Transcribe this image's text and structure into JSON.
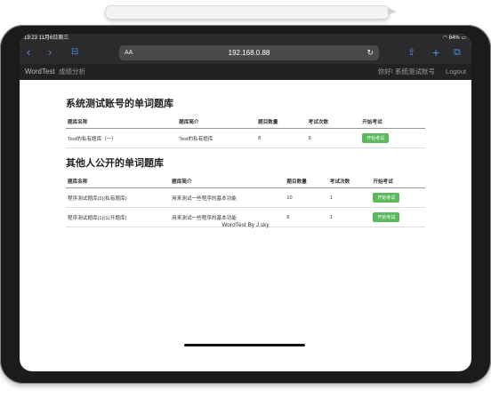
{
  "status": {
    "time_date": "19:23  11月6日周三",
    "battery": "84%"
  },
  "browser": {
    "address": "192.168.0.88",
    "aa_label": "AA",
    "icons": [
      "back-icon",
      "forward-icon",
      "bookmarks-icon",
      "reload-icon",
      "share-icon",
      "new-tab-icon",
      "tabs-icon"
    ]
  },
  "nav": {
    "brand": "WordTest",
    "link_analysis": "成绩分析",
    "greeting": "你好! 系统测试账号",
    "logout": "Logout"
  },
  "section1": {
    "title": "系统测试账号的单词题库",
    "headers": [
      "题库名称",
      "题库简介",
      "题目数量",
      "考试次数",
      "开始考试"
    ],
    "rows": [
      {
        "name": "Test的私有题库（一）",
        "desc": "Test的私有题库",
        "count": "8",
        "exams": "6",
        "button": "开始考试"
      }
    ]
  },
  "section2": {
    "title": "其他人公开的单词题库",
    "headers": [
      "题库名称",
      "题库简介",
      "题目数量",
      "考试次数",
      "开始考试"
    ],
    "rows": [
      {
        "name": "程序测试题库(2)(私有题库)",
        "desc": "用来测试一些程序的基本功能",
        "count": "10",
        "exams": "1",
        "button": "开始考试"
      },
      {
        "name": "程序测试题库(1)(公开题库)",
        "desc": "用来测试一些程序的基本功能",
        "count": "6",
        "exams": "1",
        "button": "开始考试"
      }
    ]
  },
  "footer": "WordTest By J.sky"
}
